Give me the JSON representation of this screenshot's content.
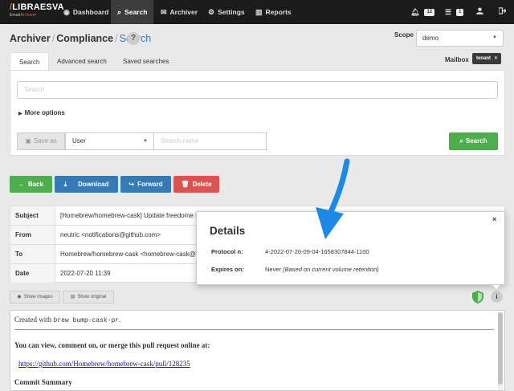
{
  "brand": {
    "name_prefix": "/",
    "name": "LIBRAESVA",
    "product_a": "Email",
    "product_b": "Archiver"
  },
  "nav": {
    "items": [
      {
        "label": "Dashboard",
        "icon": "dashboard-icon"
      },
      {
        "label": "Search",
        "icon": "search-icon",
        "active": true
      },
      {
        "label": "Archiver",
        "icon": "envelope-icon"
      },
      {
        "label": "Settings",
        "icon": "gear-icon"
      },
      {
        "label": "Reports",
        "icon": "bar-chart-icon"
      }
    ],
    "notifications_count": "12",
    "tasks_count": "1"
  },
  "header": {
    "crumb1": "Archiver",
    "crumb2": "Compliance",
    "crumb3": "Search",
    "help": "?"
  },
  "scope": {
    "label": "Scope",
    "value": "demo"
  },
  "tabs": [
    "Search",
    "Advanced search",
    "Saved searches"
  ],
  "mailbox": {
    "label": "Mailbox",
    "tag": "tenant",
    "tag_remove": "×"
  },
  "search": {
    "placeholder": "Search",
    "more_options": "More options",
    "save_as": "Save as",
    "user_option": "User",
    "name_placeholder": "Search name",
    "button": "Search"
  },
  "actions": {
    "back": "Back",
    "download": "Download",
    "forward": "Forward",
    "delete": "Delete"
  },
  "colors": {
    "back": "#4cae4c",
    "download": "#337ab7",
    "forward": "#337ab7",
    "delete": "#d9534f",
    "accent": "#1e88e5",
    "nav_bg": "#1b1b1b"
  },
  "message": {
    "rows": [
      {
        "key": "Subject",
        "value": "[Homebrew/homebrew-cask] Update freedome fr"
      },
      {
        "key": "From",
        "value": "neutric <notifications@github.com>"
      },
      {
        "key": "To",
        "value": "Homebrew/homebrew-cask <homebrew-cask@no"
      },
      {
        "key": "Date",
        "value": "2022-07-20 11:39"
      }
    ]
  },
  "view": {
    "show_images": "Show images",
    "show_original": "Show original"
  },
  "email": {
    "line1_prefix": "Created with ",
    "line1_code": "brew bump-cask-pr",
    "line1_suffix": ".",
    "line2": "You can view, comment on, or merge this pull request online at:",
    "link": "https://github.com/Homebrew/homebrew-cask/pull/128235",
    "line3": "Commit Summary"
  },
  "details": {
    "title": "Details",
    "close": "×",
    "protocol_label": "Protocol n:",
    "protocol_value": "4-2022-07-20-09-04-1658307844-1100",
    "expires_label": "Expires on:",
    "expires_value": "Never",
    "expires_note": "(Based on current volume retention)"
  }
}
